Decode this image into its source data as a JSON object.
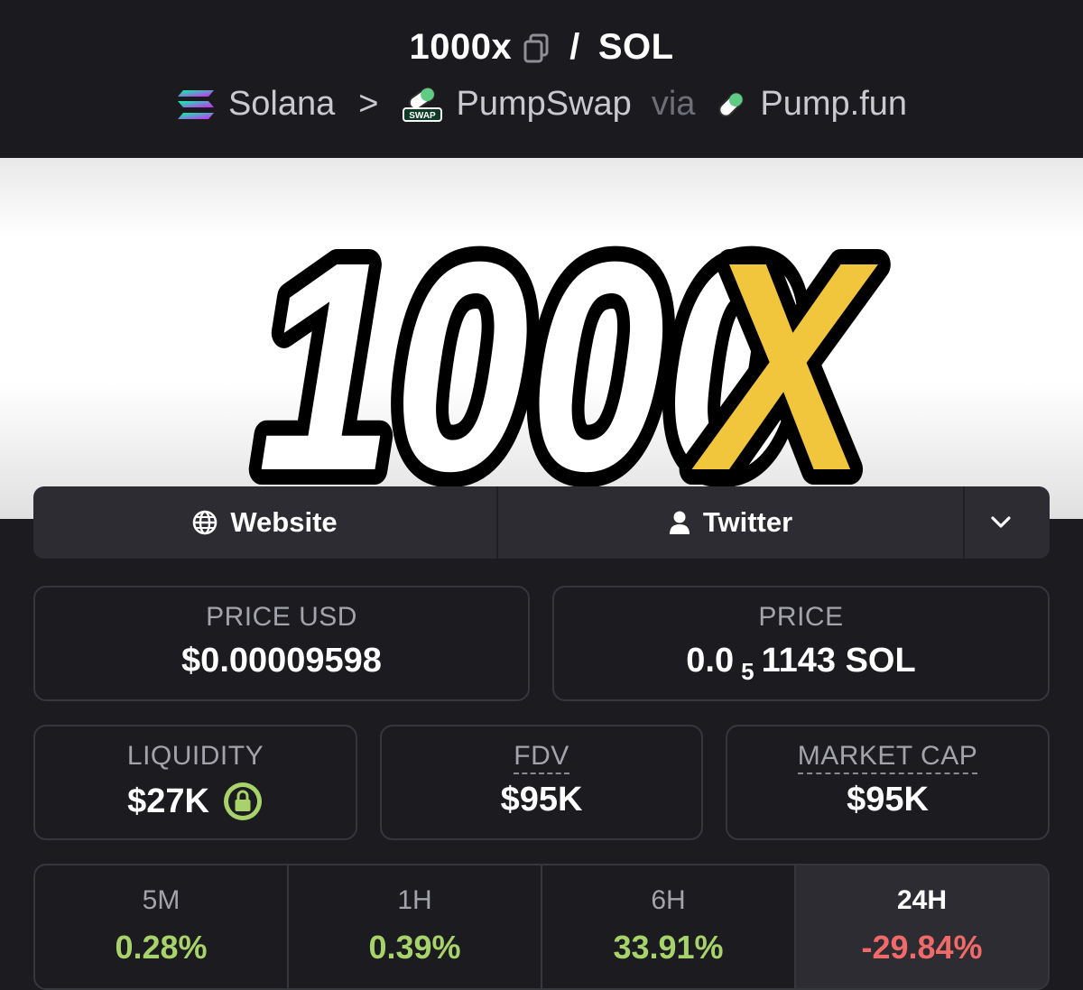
{
  "header": {
    "token_symbol": "1000x",
    "slash": "/",
    "quote_symbol": "SOL",
    "chain": "Solana",
    "separator": ">",
    "dex": "PumpSwap",
    "swap_badge": "SWAP",
    "via": "via",
    "launchpad": "Pump.fun"
  },
  "banner": {
    "logo_text_white": "1000",
    "logo_text_yellow": "X",
    "logo_colors": {
      "fill": "#ffffff",
      "accent": "#f2c63c",
      "outline": "#000000"
    }
  },
  "links": {
    "website_label": "Website",
    "twitter_label": "Twitter",
    "more_icon": "chevron-down-icon"
  },
  "stats": {
    "price_usd_label": "PRICE USD",
    "price_usd_value": "$0.00009598",
    "price_label": "PRICE",
    "price_value_prefix": "0.0",
    "price_value_subscript": "5",
    "price_value_suffix": "1143 SOL",
    "liquidity_label": "LIQUIDITY",
    "liquidity_value": "$27K",
    "fdv_label": "FDV",
    "fdv_value": "$95K",
    "market_cap_label": "MARKET CAP",
    "market_cap_value": "$95K"
  },
  "changes": [
    {
      "period": "5M",
      "value": "0.28%",
      "direction": "up"
    },
    {
      "period": "1H",
      "value": "0.39%",
      "direction": "up"
    },
    {
      "period": "6H",
      "value": "33.91%",
      "direction": "up"
    },
    {
      "period": "24H",
      "value": "-29.84%",
      "direction": "down",
      "selected": true
    }
  ],
  "colors": {
    "background": "#1b1b20",
    "card_border": "#36363d",
    "positive": "#a8d36b",
    "negative": "#f06a6a",
    "lock_badge": "#a8d36b"
  }
}
